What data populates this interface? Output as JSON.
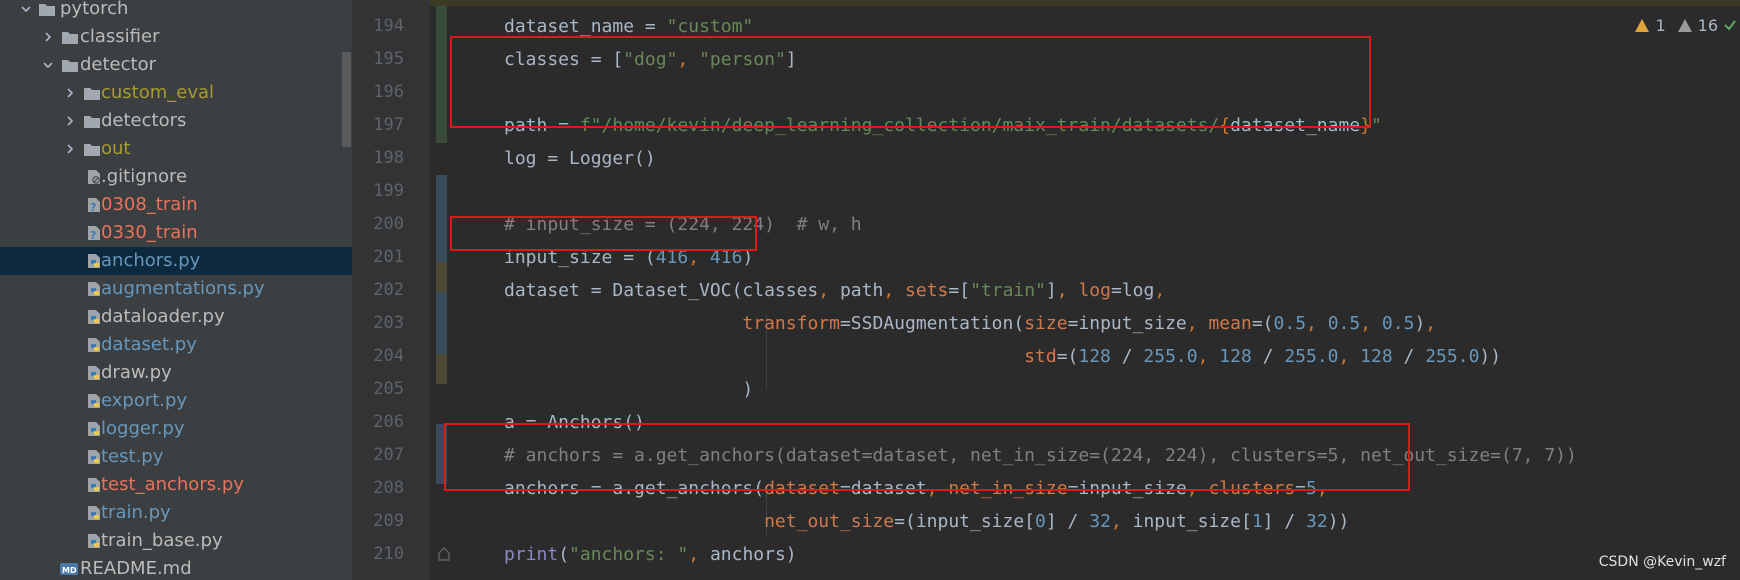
{
  "colors": {
    "sidebar_bg": "#3c3f41",
    "editor_bg": "#2b2b2b",
    "selection": "#0d293e",
    "highlight_box": "#e01818",
    "folder_label": "#bbbbbb",
    "excluded_folder_label": "#a89b2c",
    "modified_file": "#6897bb",
    "untracked_file": "#e8735a",
    "normal_file": "#a9b7c6",
    "keyword": "#cc7832",
    "string": "#6a8759",
    "number": "#6897bb",
    "comment": "#808080",
    "param": "#d2794c"
  },
  "tree": [
    {
      "label": "pytorch",
      "depth": 0,
      "type": "folder",
      "expanded": true,
      "color": "#bbbbbb"
    },
    {
      "label": "classifier",
      "depth": 1,
      "type": "folder",
      "expanded": false,
      "color": "#bbbbbb"
    },
    {
      "label": "detector",
      "depth": 1,
      "type": "folder",
      "expanded": true,
      "color": "#bbbbbb"
    },
    {
      "label": "custom_eval",
      "depth": 2,
      "type": "folder",
      "expanded": false,
      "color": "#a89b2c"
    },
    {
      "label": "detectors",
      "depth": 2,
      "type": "folder",
      "expanded": false,
      "color": "#bbbbbb"
    },
    {
      "label": "out",
      "depth": 2,
      "type": "folder",
      "expanded": false,
      "color": "#a89b2c"
    },
    {
      "label": ".gitignore",
      "depth": 3,
      "type": "gitignore",
      "color": "#bbbbbb"
    },
    {
      "label": "0308_train",
      "depth": 3,
      "type": "unknown",
      "color": "#e8735a"
    },
    {
      "label": "0330_train",
      "depth": 3,
      "type": "unknown",
      "color": "#e8735a"
    },
    {
      "label": "anchors.py",
      "depth": 3,
      "type": "python",
      "color": "#6897bb",
      "selected": true
    },
    {
      "label": "augmentations.py",
      "depth": 3,
      "type": "python",
      "color": "#6897bb"
    },
    {
      "label": "dataloader.py",
      "depth": 3,
      "type": "python",
      "color": "#bbbbbb"
    },
    {
      "label": "dataset.py",
      "depth": 3,
      "type": "python",
      "color": "#6897bb"
    },
    {
      "label": "draw.py",
      "depth": 3,
      "type": "python",
      "color": "#bbbbbb"
    },
    {
      "label": "export.py",
      "depth": 3,
      "type": "python",
      "color": "#6897bb"
    },
    {
      "label": "logger.py",
      "depth": 3,
      "type": "python",
      "color": "#6897bb"
    },
    {
      "label": "test.py",
      "depth": 3,
      "type": "python",
      "color": "#6897bb"
    },
    {
      "label": "test_anchors.py",
      "depth": 3,
      "type": "python",
      "color": "#e8735a"
    },
    {
      "label": "train.py",
      "depth": 3,
      "type": "python",
      "color": "#6897bb"
    },
    {
      "label": "train_base.py",
      "depth": 3,
      "type": "python",
      "color": "#bbbbbb"
    },
    {
      "label": "README.md",
      "depth": 2,
      "type": "markdown",
      "color": "#bbbbbb"
    }
  ],
  "inspections": {
    "warnings": "1",
    "weak_warnings": "16"
  },
  "line_numbers": [
    "194",
    "195",
    "196",
    "197",
    "198",
    "199",
    "200",
    "201",
    "202",
    "203",
    "204",
    "205",
    "206",
    "207",
    "208",
    "209",
    "210"
  ],
  "code_lines": [
    [
      [
        "dataset_name = ",
        "d"
      ],
      [
        "\"custom\"",
        "s"
      ]
    ],
    [
      [
        "classes = [",
        "d"
      ],
      [
        "\"dog\"",
        "s"
      ],
      [
        ", ",
        "k"
      ],
      [
        "\"person\"",
        "s"
      ],
      [
        "]",
        "d"
      ]
    ],
    [],
    [
      [
        "path = ",
        "d"
      ],
      [
        "f\"/home/kevin/deep_learning_collection/maix_train/datasets/",
        "s"
      ],
      [
        "{",
        "k"
      ],
      [
        "dataset_name",
        "d"
      ],
      [
        "}",
        "k"
      ],
      [
        "\"",
        "s"
      ]
    ],
    [
      [
        "log = Logger()",
        "d"
      ]
    ],
    [],
    [
      [
        "# input_size = (224, 224)  # w, h",
        "c"
      ]
    ],
    [
      [
        "input_size = (",
        "d"
      ],
      [
        "416",
        "n"
      ],
      [
        ", ",
        "k"
      ],
      [
        "416",
        "n"
      ],
      [
        ")",
        "d"
      ]
    ],
    [
      [
        "dataset = Dataset_VOC(classes",
        "d"
      ],
      [
        ", ",
        "k"
      ],
      [
        "path",
        "d"
      ],
      [
        ", ",
        "k"
      ],
      [
        "sets",
        "p"
      ],
      [
        "=[",
        "d"
      ],
      [
        "\"train\"",
        "s"
      ],
      [
        "]",
        "d"
      ],
      [
        ", ",
        "k"
      ],
      [
        "log",
        "p"
      ],
      [
        "=log",
        "d"
      ],
      [
        ",",
        "k"
      ]
    ],
    [
      [
        "                      ",
        "d"
      ],
      [
        "transform",
        "p"
      ],
      [
        "=SSDAugmentation(",
        "d"
      ],
      [
        "size",
        "p"
      ],
      [
        "=input_size",
        "d"
      ],
      [
        ", ",
        "k"
      ],
      [
        "mean",
        "p"
      ],
      [
        "=(",
        "d"
      ],
      [
        "0.5",
        "n"
      ],
      [
        ", ",
        "k"
      ],
      [
        "0.5",
        "n"
      ],
      [
        ", ",
        "k"
      ],
      [
        "0.5",
        "n"
      ],
      [
        ")",
        "d"
      ],
      [
        ",",
        "k"
      ]
    ],
    [
      [
        "                                                ",
        "d"
      ],
      [
        "std",
        "p"
      ],
      [
        "=(",
        "d"
      ],
      [
        "128",
        "n"
      ],
      [
        " / ",
        "d"
      ],
      [
        "255.0",
        "n"
      ],
      [
        ", ",
        "k"
      ],
      [
        "128",
        "n"
      ],
      [
        " / ",
        "d"
      ],
      [
        "255.0",
        "n"
      ],
      [
        ", ",
        "k"
      ],
      [
        "128",
        "n"
      ],
      [
        " / ",
        "d"
      ],
      [
        "255.0",
        "n"
      ],
      [
        "))",
        "d"
      ]
    ],
    [
      [
        "                      )",
        "d"
      ]
    ],
    [
      [
        "a = Anchors()",
        "d"
      ]
    ],
    [
      [
        "# anchors = a.get_anchors(dataset=dataset, net_in_size=(224, 224), clusters=5, net_out_size=(7, 7))",
        "c"
      ]
    ],
    [
      [
        "anchors = a.get_anchors(",
        "d"
      ],
      [
        "dataset",
        "p"
      ],
      [
        "=dataset",
        "d"
      ],
      [
        ", ",
        "k"
      ],
      [
        "net_in_size",
        "p"
      ],
      [
        "=input_size",
        "d"
      ],
      [
        ", ",
        "k"
      ],
      [
        "clusters",
        "p"
      ],
      [
        "=",
        "d"
      ],
      [
        "5",
        "n"
      ],
      [
        ",",
        "k"
      ]
    ],
    [
      [
        "                        ",
        "d"
      ],
      [
        "net_out_size",
        "p"
      ],
      [
        "=(input_size[",
        "d"
      ],
      [
        "0",
        "n"
      ],
      [
        "] / ",
        "d"
      ],
      [
        "32",
        "n"
      ],
      [
        ", ",
        "k"
      ],
      [
        "input_size[",
        "d"
      ],
      [
        "1",
        "n"
      ],
      [
        "] / ",
        "d"
      ],
      [
        "32",
        "n"
      ],
      [
        "))",
        "d"
      ]
    ],
    [
      [
        "print",
        "b"
      ],
      [
        "(",
        "d"
      ],
      [
        "\"anchors: \"",
        "s"
      ],
      [
        ", ",
        "k"
      ],
      [
        "anchors)",
        "d"
      ]
    ]
  ],
  "watermark": "CSDN @Kevin_wzf"
}
